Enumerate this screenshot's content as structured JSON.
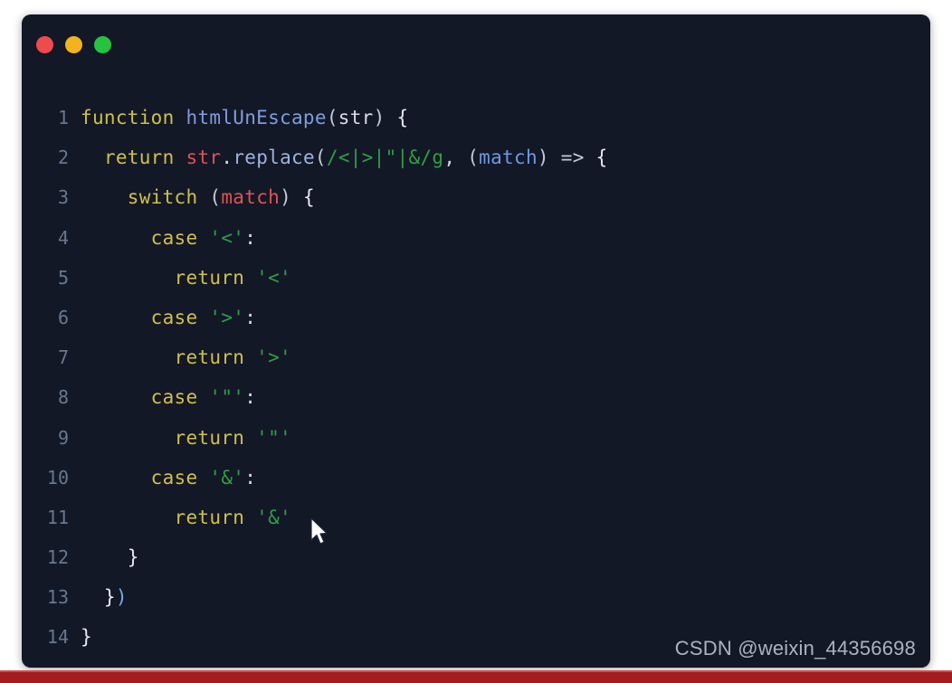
{
  "window": {
    "background_color": "#131827",
    "page_background_color": "#ffffff",
    "traffic_lights": [
      {
        "name": "close",
        "color": "#ef4b4b"
      },
      {
        "name": "minimize",
        "color": "#f3b320"
      },
      {
        "name": "maximize",
        "color": "#26c341"
      }
    ]
  },
  "editor": {
    "language": "javascript",
    "line_number_color": "#67788f",
    "lines": [
      {
        "number": "1",
        "text": "function htmlUnEscape(str) {",
        "tokens": [
          {
            "t": "function",
            "c": "t-kw"
          },
          {
            "t": " ",
            "c": "t-plain"
          },
          {
            "t": "htmlUnEscape",
            "c": "t-fn"
          },
          {
            "t": "(",
            "c": "t-punc"
          },
          {
            "t": "str",
            "c": "t-plain"
          },
          {
            "t": ")",
            "c": "t-punc"
          },
          {
            "t": " ",
            "c": "t-plain"
          },
          {
            "t": "{",
            "c": "t-brace"
          }
        ]
      },
      {
        "number": "2",
        "text": "  return str.replace(/&lt;|&gt;|&quot;|&amp;/g, (match) => {",
        "tokens": [
          {
            "t": "  ",
            "c": "t-plain"
          },
          {
            "t": "return",
            "c": "t-kw"
          },
          {
            "t": " ",
            "c": "t-plain"
          },
          {
            "t": "str",
            "c": "t-var"
          },
          {
            "t": ".",
            "c": "t-plain"
          },
          {
            "t": "replace",
            "c": "t-prop"
          },
          {
            "t": "(",
            "c": "t-punc"
          },
          {
            "t": "/&lt;|&gt;|&quot;|&amp;/g",
            "c": "t-str"
          },
          {
            "t": ",",
            "c": "t-plain"
          },
          {
            "t": " ",
            "c": "t-plain"
          },
          {
            "t": "(",
            "c": "t-punc"
          },
          {
            "t": "match",
            "c": "t-param"
          },
          {
            "t": ")",
            "c": "t-punc"
          },
          {
            "t": " ",
            "c": "t-plain"
          },
          {
            "t": "=>",
            "c": "t-punc"
          },
          {
            "t": " ",
            "c": "t-plain"
          },
          {
            "t": "{",
            "c": "t-brace"
          }
        ]
      },
      {
        "number": "3",
        "text": "    switch (match) {",
        "tokens": [
          {
            "t": "    ",
            "c": "t-plain"
          },
          {
            "t": "switch",
            "c": "t-kw"
          },
          {
            "t": " ",
            "c": "t-plain"
          },
          {
            "t": "(",
            "c": "t-punc"
          },
          {
            "t": "match",
            "c": "t-var"
          },
          {
            "t": ")",
            "c": "t-punc"
          },
          {
            "t": " ",
            "c": "t-plain"
          },
          {
            "t": "{",
            "c": "t-brace"
          }
        ]
      },
      {
        "number": "4",
        "text": "      case '&lt;':",
        "tokens": [
          {
            "t": "      ",
            "c": "t-plain"
          },
          {
            "t": "case",
            "c": "t-kw"
          },
          {
            "t": " ",
            "c": "t-plain"
          },
          {
            "t": "'&lt;'",
            "c": "t-str"
          },
          {
            "t": ":",
            "c": "t-plain"
          }
        ]
      },
      {
        "number": "5",
        "text": "        return '<'",
        "tokens": [
          {
            "t": "        ",
            "c": "t-plain"
          },
          {
            "t": "return",
            "c": "t-kw"
          },
          {
            "t": " ",
            "c": "t-plain"
          },
          {
            "t": "'<'",
            "c": "t-str"
          }
        ]
      },
      {
        "number": "6",
        "text": "      case '&gt;':",
        "tokens": [
          {
            "t": "      ",
            "c": "t-plain"
          },
          {
            "t": "case",
            "c": "t-kw"
          },
          {
            "t": " ",
            "c": "t-plain"
          },
          {
            "t": "'&gt;'",
            "c": "t-str"
          },
          {
            "t": ":",
            "c": "t-plain"
          }
        ]
      },
      {
        "number": "7",
        "text": "        return '>'",
        "tokens": [
          {
            "t": "        ",
            "c": "t-plain"
          },
          {
            "t": "return",
            "c": "t-kw"
          },
          {
            "t": " ",
            "c": "t-plain"
          },
          {
            "t": "'>'",
            "c": "t-str"
          }
        ]
      },
      {
        "number": "8",
        "text": "      case '&quot;':",
        "tokens": [
          {
            "t": "      ",
            "c": "t-plain"
          },
          {
            "t": "case",
            "c": "t-kw"
          },
          {
            "t": " ",
            "c": "t-plain"
          },
          {
            "t": "'&quot;'",
            "c": "t-str"
          },
          {
            "t": ":",
            "c": "t-plain"
          }
        ]
      },
      {
        "number": "9",
        "text": "        return '\"'",
        "tokens": [
          {
            "t": "        ",
            "c": "t-plain"
          },
          {
            "t": "return",
            "c": "t-kw"
          },
          {
            "t": " ",
            "c": "t-plain"
          },
          {
            "t": "'\"'",
            "c": "t-str"
          }
        ]
      },
      {
        "number": "10",
        "text": "      case '&amp;':",
        "tokens": [
          {
            "t": "      ",
            "c": "t-plain"
          },
          {
            "t": "case",
            "c": "t-kw"
          },
          {
            "t": " ",
            "c": "t-plain"
          },
          {
            "t": "'&amp;'",
            "c": "t-str"
          },
          {
            "t": ":",
            "c": "t-plain"
          }
        ]
      },
      {
        "number": "11",
        "text": "        return '&'",
        "tokens": [
          {
            "t": "        ",
            "c": "t-plain"
          },
          {
            "t": "return",
            "c": "t-kw"
          },
          {
            "t": " ",
            "c": "t-plain"
          },
          {
            "t": "'&'",
            "c": "t-str"
          }
        ]
      },
      {
        "number": "12",
        "text": "    }",
        "tokens": [
          {
            "t": "    ",
            "c": "t-plain"
          },
          {
            "t": "}",
            "c": "t-brace"
          }
        ]
      },
      {
        "number": "13",
        "text": "  })",
        "tokens": [
          {
            "t": "  ",
            "c": "t-plain"
          },
          {
            "t": "}",
            "c": "t-brace"
          },
          {
            "t": ")",
            "c": "t-paren-b"
          }
        ]
      },
      {
        "number": "14",
        "text": "}",
        "tokens": [
          {
            "t": "}",
            "c": "t-brace"
          }
        ]
      }
    ]
  },
  "watermark": {
    "text": "CSDN @weixin_44356698"
  },
  "bottom_bar": {
    "color": "#a31c20"
  }
}
